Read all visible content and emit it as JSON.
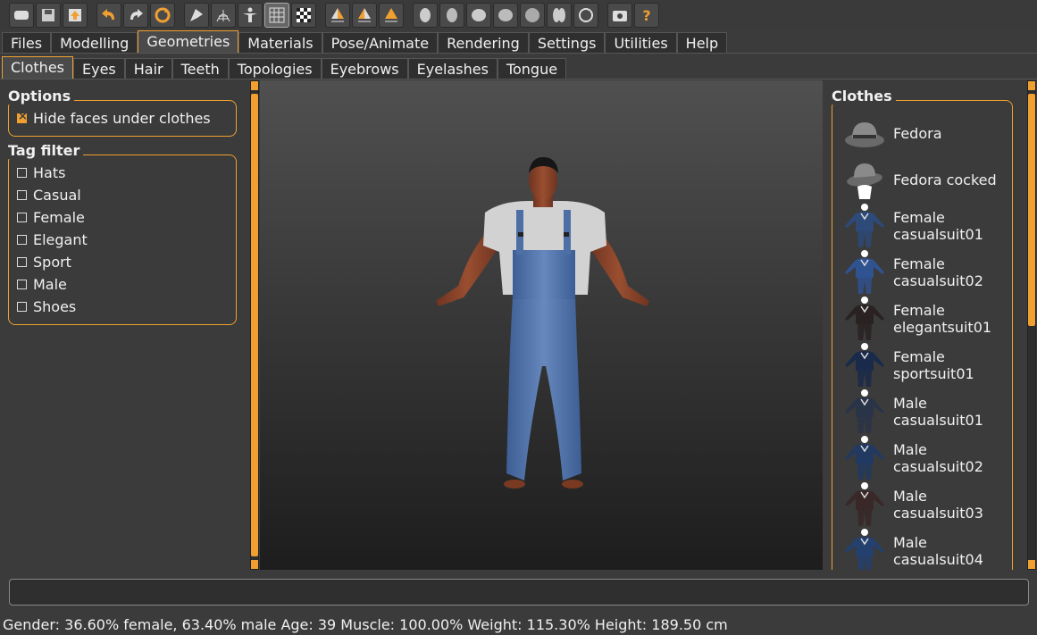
{
  "toolbar": {
    "buttons": [
      {
        "icon": "mesh-icon"
      },
      {
        "icon": "save-icon"
      },
      {
        "icon": "export-icon"
      },
      {
        "icon": "undo-icon"
      },
      {
        "icon": "redo-icon"
      },
      {
        "icon": "reset-icon"
      },
      {
        "icon": "smooth-icon"
      },
      {
        "icon": "wireframe-icon"
      },
      {
        "icon": "pose-icon"
      },
      {
        "icon": "grid-icon"
      },
      {
        "icon": "background-icon"
      },
      {
        "icon": "symmetry-right-icon"
      },
      {
        "icon": "symmetry-left-icon"
      },
      {
        "icon": "symmetry-icon"
      },
      {
        "icon": "front-view-icon"
      },
      {
        "icon": "back-view-icon"
      },
      {
        "icon": "left-view-icon"
      },
      {
        "icon": "right-view-icon"
      },
      {
        "icon": "top-view-icon"
      },
      {
        "icon": "bottom-view-icon"
      },
      {
        "icon": "reset-camera-icon"
      },
      {
        "icon": "screenshot-icon"
      },
      {
        "icon": "help-icon"
      }
    ]
  },
  "main_tabs": [
    "Files",
    "Modelling",
    "Geometries",
    "Materials",
    "Pose/Animate",
    "Rendering",
    "Settings",
    "Utilities",
    "Help"
  ],
  "main_tab_active": "Geometries",
  "sub_tabs": [
    "Clothes",
    "Eyes",
    "Hair",
    "Teeth",
    "Topologies",
    "Eyebrows",
    "Eyelashes",
    "Tongue"
  ],
  "sub_tab_active": "Clothes",
  "options": {
    "title": "Options",
    "hide_faces_label": "Hide faces under clothes",
    "hide_faces_checked": true
  },
  "tag_filter": {
    "title": "Tag filter",
    "tags": [
      "Hats",
      "Casual",
      "Female",
      "Elegant",
      "Sport",
      "Male",
      "Shoes"
    ]
  },
  "clothes": {
    "title": "Clothes",
    "items": [
      {
        "line1": "Fedora",
        "line2": "",
        "icon": "fedora-icon"
      },
      {
        "line1": "Fedora cocked",
        "line2": "",
        "icon": "fedora-cocked-icon"
      },
      {
        "line1": "Female",
        "line2": "casualsuit01",
        "icon": "suit-icon",
        "color": "#2d4a78"
      },
      {
        "line1": "Female",
        "line2": "casualsuit02",
        "icon": "suit-icon",
        "color": "#2f5290"
      },
      {
        "line1": "Female",
        "line2": "elegantsuit01",
        "icon": "suit-icon",
        "color": "#2a2222"
      },
      {
        "line1": "Female",
        "line2": "sportsuit01",
        "icon": "suit-icon",
        "color": "#1a2a4a"
      },
      {
        "line1": "Male",
        "line2": "casualsuit01",
        "icon": "suit-icon",
        "color": "#2a3448"
      },
      {
        "line1": "Male",
        "line2": "casualsuit02",
        "icon": "suit-icon",
        "color": "#223a62"
      },
      {
        "line1": "Male",
        "line2": "casualsuit03",
        "icon": "suit-icon",
        "color": "#3a2828"
      },
      {
        "line1": "Male",
        "line2": "casualsuit04",
        "icon": "suit-icon",
        "color": "#24406e"
      }
    ]
  },
  "command": {
    "value": ""
  },
  "status": "Gender: 36.60% female, 63.40% male Age: 39 Muscle: 100.00% Weight: 115.30% Height: 189.50 cm",
  "colors": {
    "accent": "#f0a030",
    "background": "#3b3b3b"
  }
}
